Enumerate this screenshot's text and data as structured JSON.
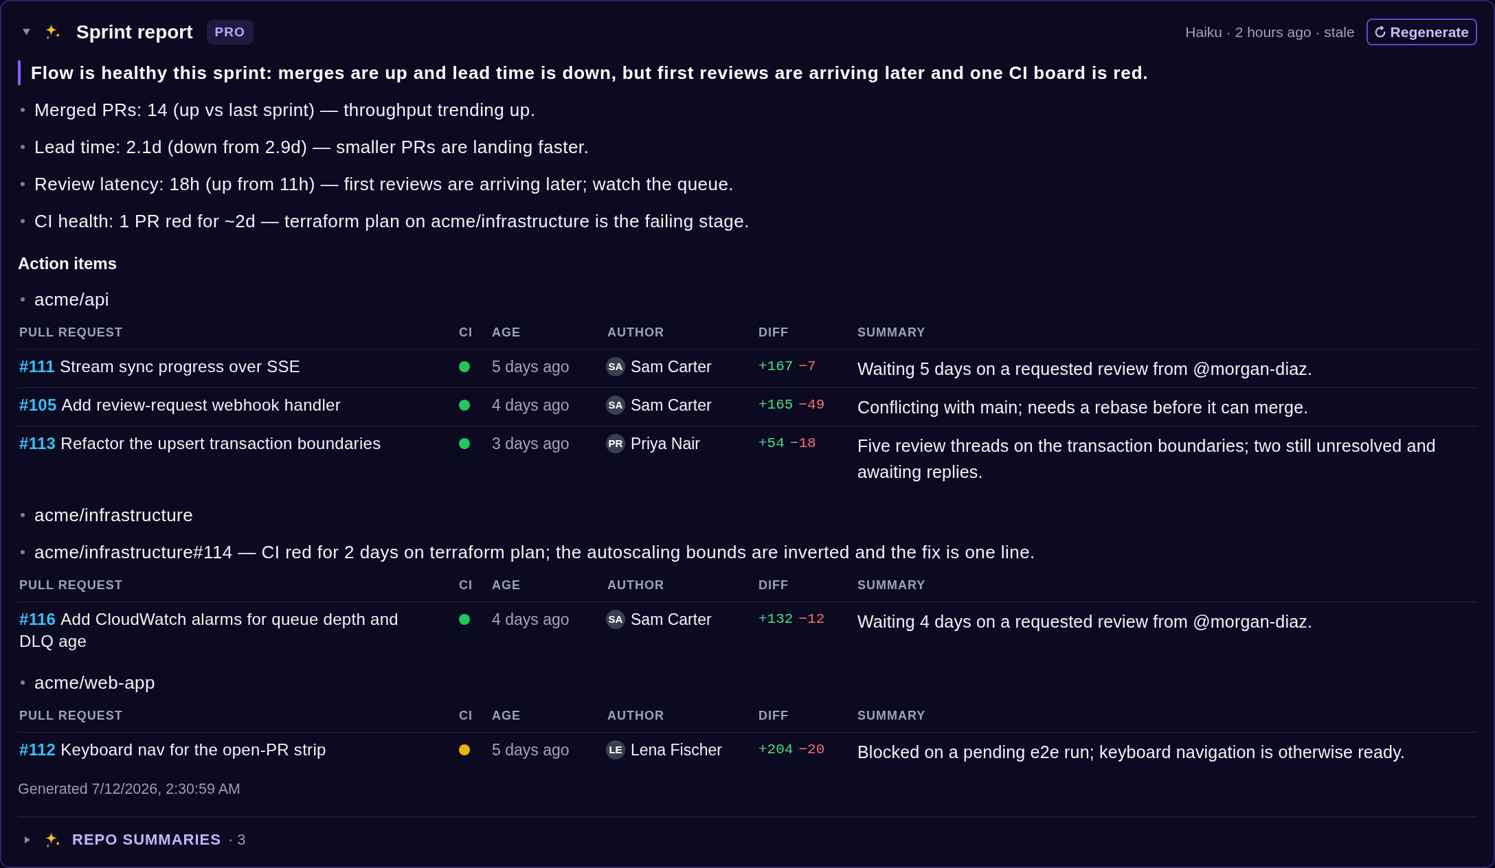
{
  "report": {
    "expanded": true,
    "title": "Sprint report",
    "badge": "PRO",
    "meta": "Haiku · 2 hours ago · stale",
    "regenerate_button": "Regenerate",
    "headline": "Flow is healthy this sprint: merges are up and lead time is down, but first reviews are arriving later and one CI board is red.",
    "highlights": [
      "Merged PRs: 14 (up vs last sprint) — throughput trending up.",
      "Lead time: 2.1d (down from 2.9d) — smaller PRs are landing faster.",
      "Review latency: 18h (up from 11h) — first reviews are arriving later; watch the queue.",
      "CI health: 1 PR red for ~2d — terraform plan on acme/infrastructure is the failing stage."
    ],
    "action_items": {
      "heading": "Action items",
      "groups": [
        {
          "repo": "acme/api",
          "columns": [
            "PULL REQUEST",
            "CI",
            "AGE",
            "AUTHOR",
            "DIFF",
            "SUMMARY"
          ],
          "pull_requests": [
            {
              "number": "#111",
              "title": "Stream sync progress over SSE",
              "ci": {
                "color": "#22c55e"
              },
              "age": "5 days ago",
              "author": {
                "initials": "SA",
                "name": "Sam Carter"
              },
              "additions": "+167",
              "deletions": "−7",
              "summary": "Waiting 5 days on a requested review from @morgan-diaz."
            },
            {
              "number": "#105",
              "title": "Add review-request webhook handler",
              "ci": {
                "color": "#22c55e"
              },
              "age": "4 days ago",
              "author": {
                "initials": "SA",
                "name": "Sam Carter"
              },
              "additions": "+165",
              "deletions": "−49",
              "summary": "Conflicting with main; needs a rebase before it can merge."
            },
            {
              "number": "#113",
              "title": "Refactor the upsert transaction boundaries",
              "ci": {
                "color": "#22c55e"
              },
              "age": "3 days ago",
              "author": {
                "initials": "PR",
                "name": "Priya Nair"
              },
              "additions": "+54",
              "deletions": "−18",
              "summary": "Five review threads on the transaction boundaries; two still unresolved and awaiting replies."
            }
          ]
        },
        {
          "repo": "acme/infrastructure",
          "notes": [
            "acme/infrastructure#114 — CI red for 2 days on terraform plan; the autoscaling bounds are inverted and the fix is one line."
          ],
          "columns": [
            "PULL REQUEST",
            "CI",
            "AGE",
            "AUTHOR",
            "DIFF",
            "SUMMARY"
          ],
          "pull_requests": [
            {
              "number": "#116",
              "title": "Add CloudWatch alarms for queue depth and DLQ age",
              "ci": {
                "color": "#22c55e"
              },
              "age": "4 days ago",
              "author": {
                "initials": "SA",
                "name": "Sam Carter"
              },
              "additions": "+132",
              "deletions": "−12",
              "summary": "Waiting 4 days on a requested review from @morgan-diaz."
            }
          ]
        },
        {
          "repo": "acme/web-app",
          "columns": [
            "PULL REQUEST",
            "CI",
            "AGE",
            "AUTHOR",
            "DIFF",
            "SUMMARY"
          ],
          "pull_requests": [
            {
              "number": "#112",
              "title": "Keyboard nav for the open-PR strip",
              "ci": {
                "color": "#eab308"
              },
              "age": "5 days ago",
              "author": {
                "initials": "LE",
                "name": "Lena Fischer"
              },
              "additions": "+204",
              "deletions": "−20",
              "summary": "Blocked on a pending e2e run; keyboard navigation is otherwise ready."
            }
          ]
        }
      ]
    },
    "generated": "Generated 7/12/2026, 2:30:59 AM"
  },
  "repo_summaries": {
    "expanded": false,
    "title": "REPO SUMMARIES",
    "count": "· 3"
  }
}
